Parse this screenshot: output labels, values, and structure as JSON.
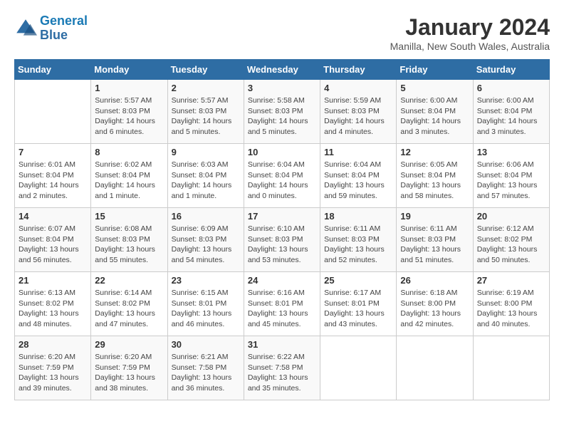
{
  "logo": {
    "line1": "General",
    "line2": "Blue"
  },
  "title": "January 2024",
  "location": "Manilla, New South Wales, Australia",
  "days_of_week": [
    "Sunday",
    "Monday",
    "Tuesday",
    "Wednesday",
    "Thursday",
    "Friday",
    "Saturday"
  ],
  "weeks": [
    [
      {
        "num": "",
        "info": ""
      },
      {
        "num": "1",
        "info": "Sunrise: 5:57 AM\nSunset: 8:03 PM\nDaylight: 14 hours\nand 6 minutes."
      },
      {
        "num": "2",
        "info": "Sunrise: 5:57 AM\nSunset: 8:03 PM\nDaylight: 14 hours\nand 5 minutes."
      },
      {
        "num": "3",
        "info": "Sunrise: 5:58 AM\nSunset: 8:03 PM\nDaylight: 14 hours\nand 5 minutes."
      },
      {
        "num": "4",
        "info": "Sunrise: 5:59 AM\nSunset: 8:03 PM\nDaylight: 14 hours\nand 4 minutes."
      },
      {
        "num": "5",
        "info": "Sunrise: 6:00 AM\nSunset: 8:04 PM\nDaylight: 14 hours\nand 3 minutes."
      },
      {
        "num": "6",
        "info": "Sunrise: 6:00 AM\nSunset: 8:04 PM\nDaylight: 14 hours\nand 3 minutes."
      }
    ],
    [
      {
        "num": "7",
        "info": "Sunrise: 6:01 AM\nSunset: 8:04 PM\nDaylight: 14 hours\nand 2 minutes."
      },
      {
        "num": "8",
        "info": "Sunrise: 6:02 AM\nSunset: 8:04 PM\nDaylight: 14 hours\nand 1 minute."
      },
      {
        "num": "9",
        "info": "Sunrise: 6:03 AM\nSunset: 8:04 PM\nDaylight: 14 hours\nand 1 minute."
      },
      {
        "num": "10",
        "info": "Sunrise: 6:04 AM\nSunset: 8:04 PM\nDaylight: 14 hours\nand 0 minutes."
      },
      {
        "num": "11",
        "info": "Sunrise: 6:04 AM\nSunset: 8:04 PM\nDaylight: 13 hours\nand 59 minutes."
      },
      {
        "num": "12",
        "info": "Sunrise: 6:05 AM\nSunset: 8:04 PM\nDaylight: 13 hours\nand 58 minutes."
      },
      {
        "num": "13",
        "info": "Sunrise: 6:06 AM\nSunset: 8:04 PM\nDaylight: 13 hours\nand 57 minutes."
      }
    ],
    [
      {
        "num": "14",
        "info": "Sunrise: 6:07 AM\nSunset: 8:04 PM\nDaylight: 13 hours\nand 56 minutes."
      },
      {
        "num": "15",
        "info": "Sunrise: 6:08 AM\nSunset: 8:03 PM\nDaylight: 13 hours\nand 55 minutes."
      },
      {
        "num": "16",
        "info": "Sunrise: 6:09 AM\nSunset: 8:03 PM\nDaylight: 13 hours\nand 54 minutes."
      },
      {
        "num": "17",
        "info": "Sunrise: 6:10 AM\nSunset: 8:03 PM\nDaylight: 13 hours\nand 53 minutes."
      },
      {
        "num": "18",
        "info": "Sunrise: 6:11 AM\nSunset: 8:03 PM\nDaylight: 13 hours\nand 52 minutes."
      },
      {
        "num": "19",
        "info": "Sunrise: 6:11 AM\nSunset: 8:03 PM\nDaylight: 13 hours\nand 51 minutes."
      },
      {
        "num": "20",
        "info": "Sunrise: 6:12 AM\nSunset: 8:02 PM\nDaylight: 13 hours\nand 50 minutes."
      }
    ],
    [
      {
        "num": "21",
        "info": "Sunrise: 6:13 AM\nSunset: 8:02 PM\nDaylight: 13 hours\nand 48 minutes."
      },
      {
        "num": "22",
        "info": "Sunrise: 6:14 AM\nSunset: 8:02 PM\nDaylight: 13 hours\nand 47 minutes."
      },
      {
        "num": "23",
        "info": "Sunrise: 6:15 AM\nSunset: 8:01 PM\nDaylight: 13 hours\nand 46 minutes."
      },
      {
        "num": "24",
        "info": "Sunrise: 6:16 AM\nSunset: 8:01 PM\nDaylight: 13 hours\nand 45 minutes."
      },
      {
        "num": "25",
        "info": "Sunrise: 6:17 AM\nSunset: 8:01 PM\nDaylight: 13 hours\nand 43 minutes."
      },
      {
        "num": "26",
        "info": "Sunrise: 6:18 AM\nSunset: 8:00 PM\nDaylight: 13 hours\nand 42 minutes."
      },
      {
        "num": "27",
        "info": "Sunrise: 6:19 AM\nSunset: 8:00 PM\nDaylight: 13 hours\nand 40 minutes."
      }
    ],
    [
      {
        "num": "28",
        "info": "Sunrise: 6:20 AM\nSunset: 7:59 PM\nDaylight: 13 hours\nand 39 minutes."
      },
      {
        "num": "29",
        "info": "Sunrise: 6:20 AM\nSunset: 7:59 PM\nDaylight: 13 hours\nand 38 minutes."
      },
      {
        "num": "30",
        "info": "Sunrise: 6:21 AM\nSunset: 7:58 PM\nDaylight: 13 hours\nand 36 minutes."
      },
      {
        "num": "31",
        "info": "Sunrise: 6:22 AM\nSunset: 7:58 PM\nDaylight: 13 hours\nand 35 minutes."
      },
      {
        "num": "",
        "info": ""
      },
      {
        "num": "",
        "info": ""
      },
      {
        "num": "",
        "info": ""
      }
    ]
  ]
}
